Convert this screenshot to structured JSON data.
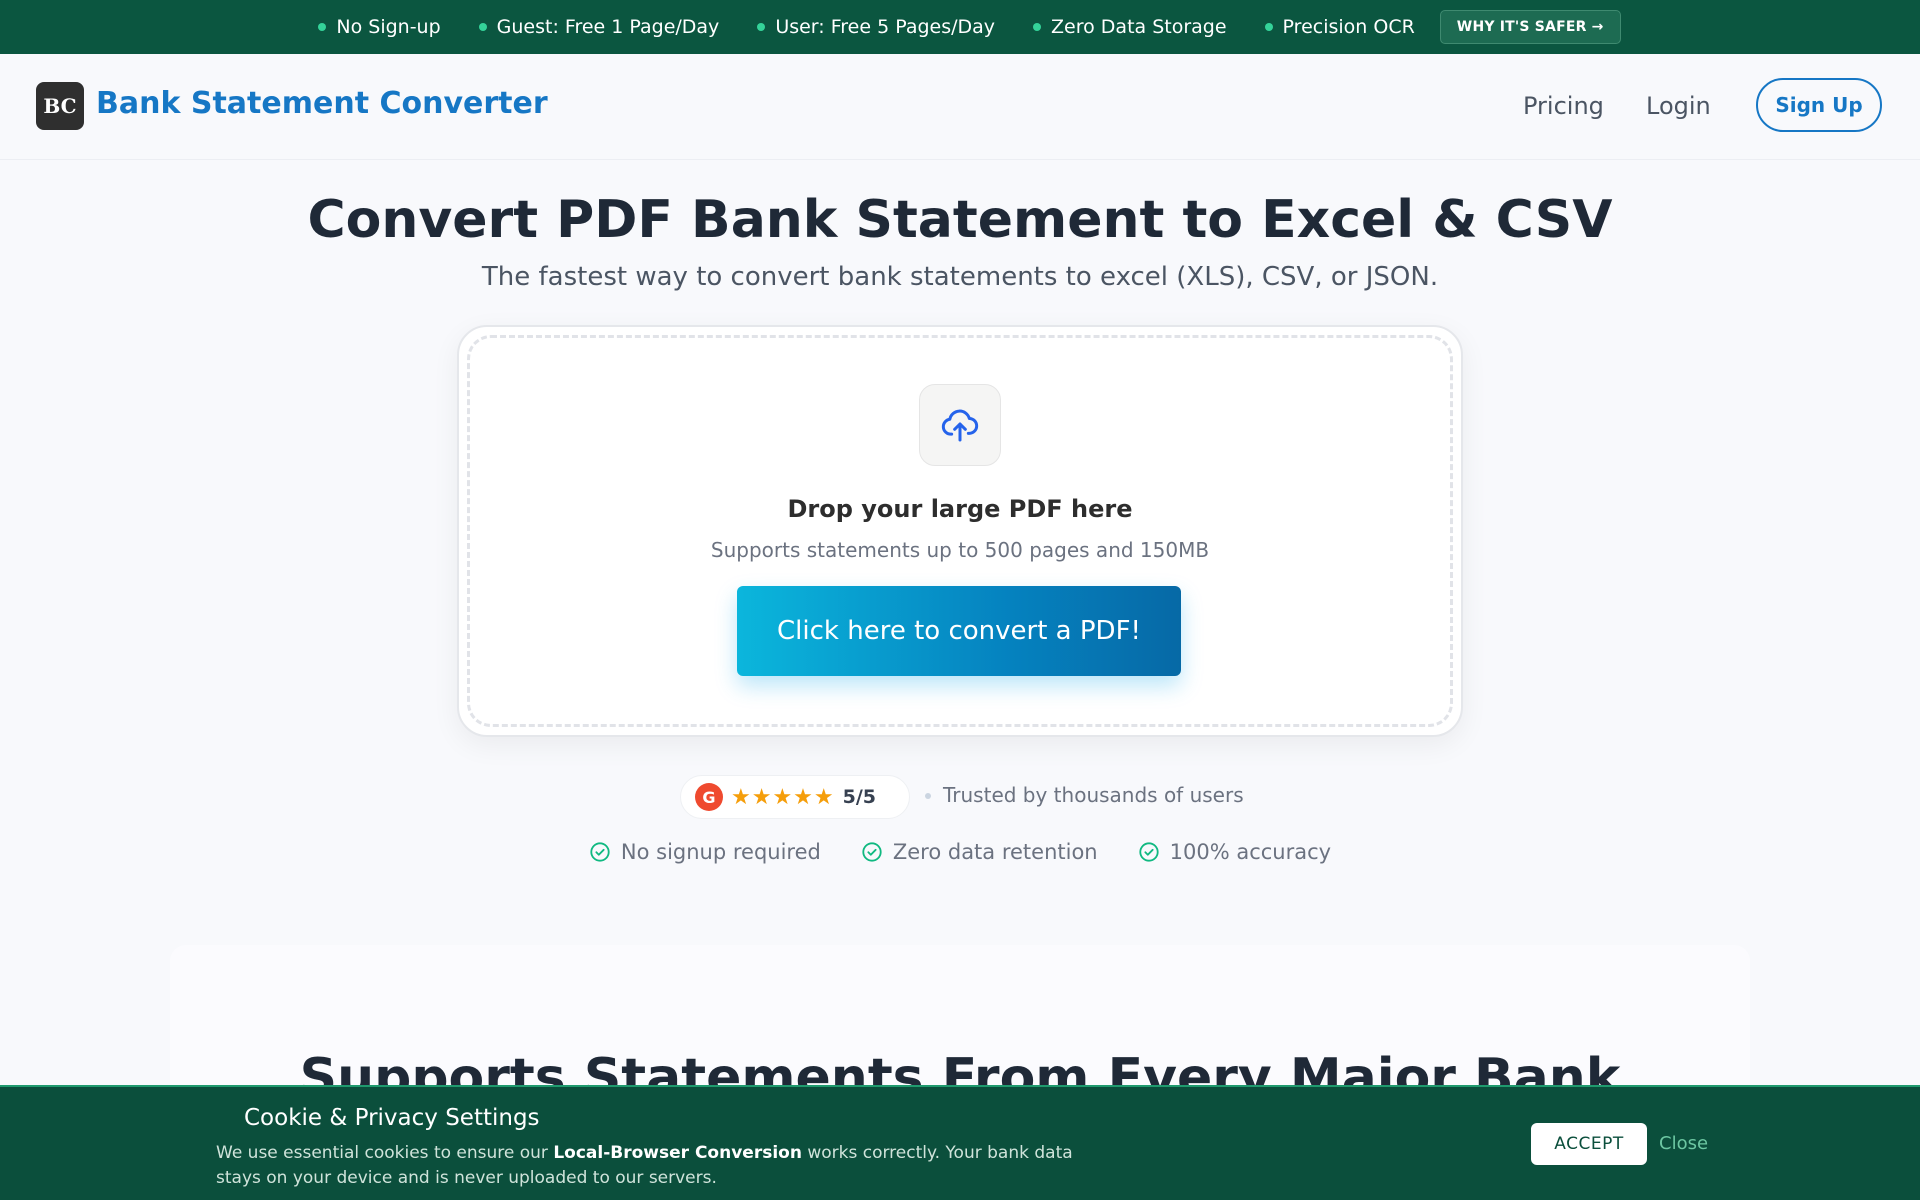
{
  "topbar": {
    "features": [
      "No Sign-up",
      "Guest: Free 1 Page/Day",
      "User: Free 5 Pages/Day",
      "Zero Data Storage",
      "Precision OCR"
    ],
    "why_label": "WHY IT'S SAFER →"
  },
  "header": {
    "logo_text": "BC",
    "brand": "Bank Statement Converter",
    "nav": {
      "pricing": "Pricing",
      "login": "Login",
      "signup": "Sign Up"
    }
  },
  "hero": {
    "title": "Convert PDF Bank Statement to Excel & CSV",
    "subtitle": "The fastest way to convert bank statements to excel (XLS), CSV, or JSON."
  },
  "upload": {
    "icon": "cloud-upload-icon",
    "title": "Drop your large PDF here",
    "subtitle": "Supports statements up to 500 pages and 150MB",
    "button": "Click here to convert a PDF!"
  },
  "rating": {
    "badge": "G",
    "stars": 5,
    "score": "5/5",
    "trusted": "Trusted by thousands of users"
  },
  "checks": [
    "No signup required",
    "Zero data retention",
    "100% accuracy"
  ],
  "section": {
    "title": "Supports Statements From Every Major Bank"
  },
  "cookie": {
    "title": "Cookie & Privacy Settings",
    "text_before": "We use essential cookies to ensure our ",
    "text_bold": "Local-Browser Conversion",
    "text_after": " works correctly. Your bank data stays on your device and is never uploaded to our servers.",
    "accept": "ACCEPT",
    "close": "Close"
  },
  "colors": {
    "topbar": "#0b5640",
    "brand": "#1677c5",
    "cookie": "#0b4f3c",
    "accent_green": "#34d399"
  }
}
